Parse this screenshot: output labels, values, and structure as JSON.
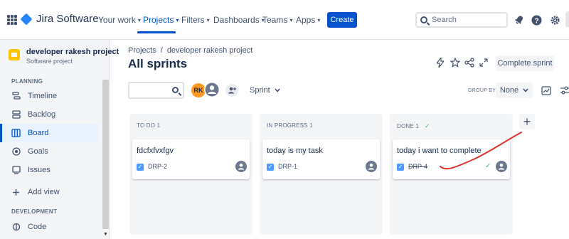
{
  "topnav": {
    "product_name": "Jira Software",
    "items": [
      {
        "label": "Your work",
        "has_chevron": true
      },
      {
        "label": "Projects",
        "has_chevron": true,
        "active": true
      },
      {
        "label": "Filters",
        "has_chevron": true
      },
      {
        "label": "Dashboards",
        "has_chevron": true
      },
      {
        "label": "Teams",
        "has_chevron": true
      },
      {
        "label": "Apps",
        "has_chevron": true
      }
    ],
    "create_label": "Create",
    "search_placeholder": "Search",
    "icons": [
      "app-switcher-icon",
      "notifications-icon",
      "help-icon",
      "settings-icon"
    ],
    "accent_color": "#0052cc"
  },
  "sidebar": {
    "project_name": "developer rakesh project",
    "project_type": "Software project",
    "planning_heading": "PLANNING",
    "items": [
      {
        "label": "Timeline",
        "icon": "timeline-icon"
      },
      {
        "label": "Backlog",
        "icon": "backlog-icon"
      },
      {
        "label": "Board",
        "icon": "board-icon",
        "active": true
      },
      {
        "label": "Goals",
        "icon": "goals-icon"
      },
      {
        "label": "Issues",
        "icon": "issues-icon"
      },
      {
        "label": "Add view",
        "icon": "plus-icon"
      }
    ],
    "development_heading": "DEVELOPMENT",
    "dev_items": [
      {
        "label": "Code",
        "icon": "code-icon"
      }
    ]
  },
  "main": {
    "breadcrumb": [
      "Projects",
      "/",
      "developer rakesh project"
    ],
    "title": "All sprints",
    "complete_sprint_label": "Complete sprint",
    "avatar_initials": "RK",
    "sprint_filter_label": "Sprint",
    "group_by_label": "GROUP BY",
    "group_by_value": "None",
    "columns": [
      {
        "heading": "TO DO 1",
        "card": {
          "title": "fdcfxfvxfgv",
          "key": "DRP-2",
          "done": false
        }
      },
      {
        "heading": "IN PROGRESS 1",
        "card": {
          "title": "today is my task",
          "key": "DRP-1",
          "done": false
        }
      },
      {
        "heading": "DONE 1",
        "heading_check": "✓",
        "card": {
          "title": "today i want to complete",
          "key": "DRP-4",
          "done": true,
          "done_mark": "✓"
        }
      }
    ],
    "add_column_label": "+",
    "annotation_color": "#e03030"
  }
}
